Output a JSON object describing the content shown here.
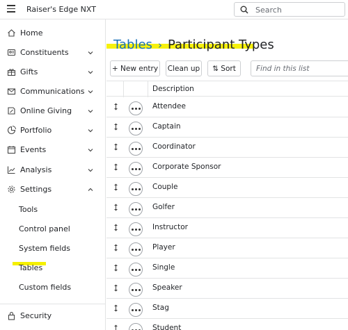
{
  "header": {
    "app_title": "Raiser's Edge NXT",
    "search_placeholder": "Search"
  },
  "sidebar": {
    "items": [
      {
        "label": "Home",
        "icon": "home-icon"
      },
      {
        "label": "Constituents",
        "icon": "constituents-icon"
      },
      {
        "label": "Gifts",
        "icon": "gift-icon"
      },
      {
        "label": "Communications",
        "icon": "mail-icon"
      },
      {
        "label": "Online Giving",
        "icon": "online-giving-icon"
      },
      {
        "label": "Portfolio",
        "icon": "portfolio-icon"
      },
      {
        "label": "Events",
        "icon": "calendar-icon"
      },
      {
        "label": "Analysis",
        "icon": "chart-icon"
      },
      {
        "label": "Settings",
        "icon": "gear-icon"
      }
    ],
    "settings_subitems": [
      "Tools",
      "Control panel",
      "System fields",
      "Tables",
      "Custom fields"
    ],
    "footer": {
      "label": "Security",
      "icon": "lock-icon"
    }
  },
  "main": {
    "breadcrumb": "Tables",
    "breadcrumb_separator": "›",
    "title": "Participant Types",
    "toolbar": {
      "new_entry": "+ New entry",
      "clean_up": "Clean up",
      "sort": "⇅ Sort",
      "find_placeholder": "Find in this list"
    },
    "table": {
      "column_header": "Description",
      "rows": [
        "Attendee",
        "Captain",
        "Coordinator",
        "Corporate Sponsor",
        "Couple",
        "Golfer",
        "Instructor",
        "Player",
        "Single",
        "Speaker",
        "Stag",
        "Student"
      ]
    }
  },
  "colors": {
    "accent": "#1870b8",
    "highlight": "#f5f000"
  }
}
